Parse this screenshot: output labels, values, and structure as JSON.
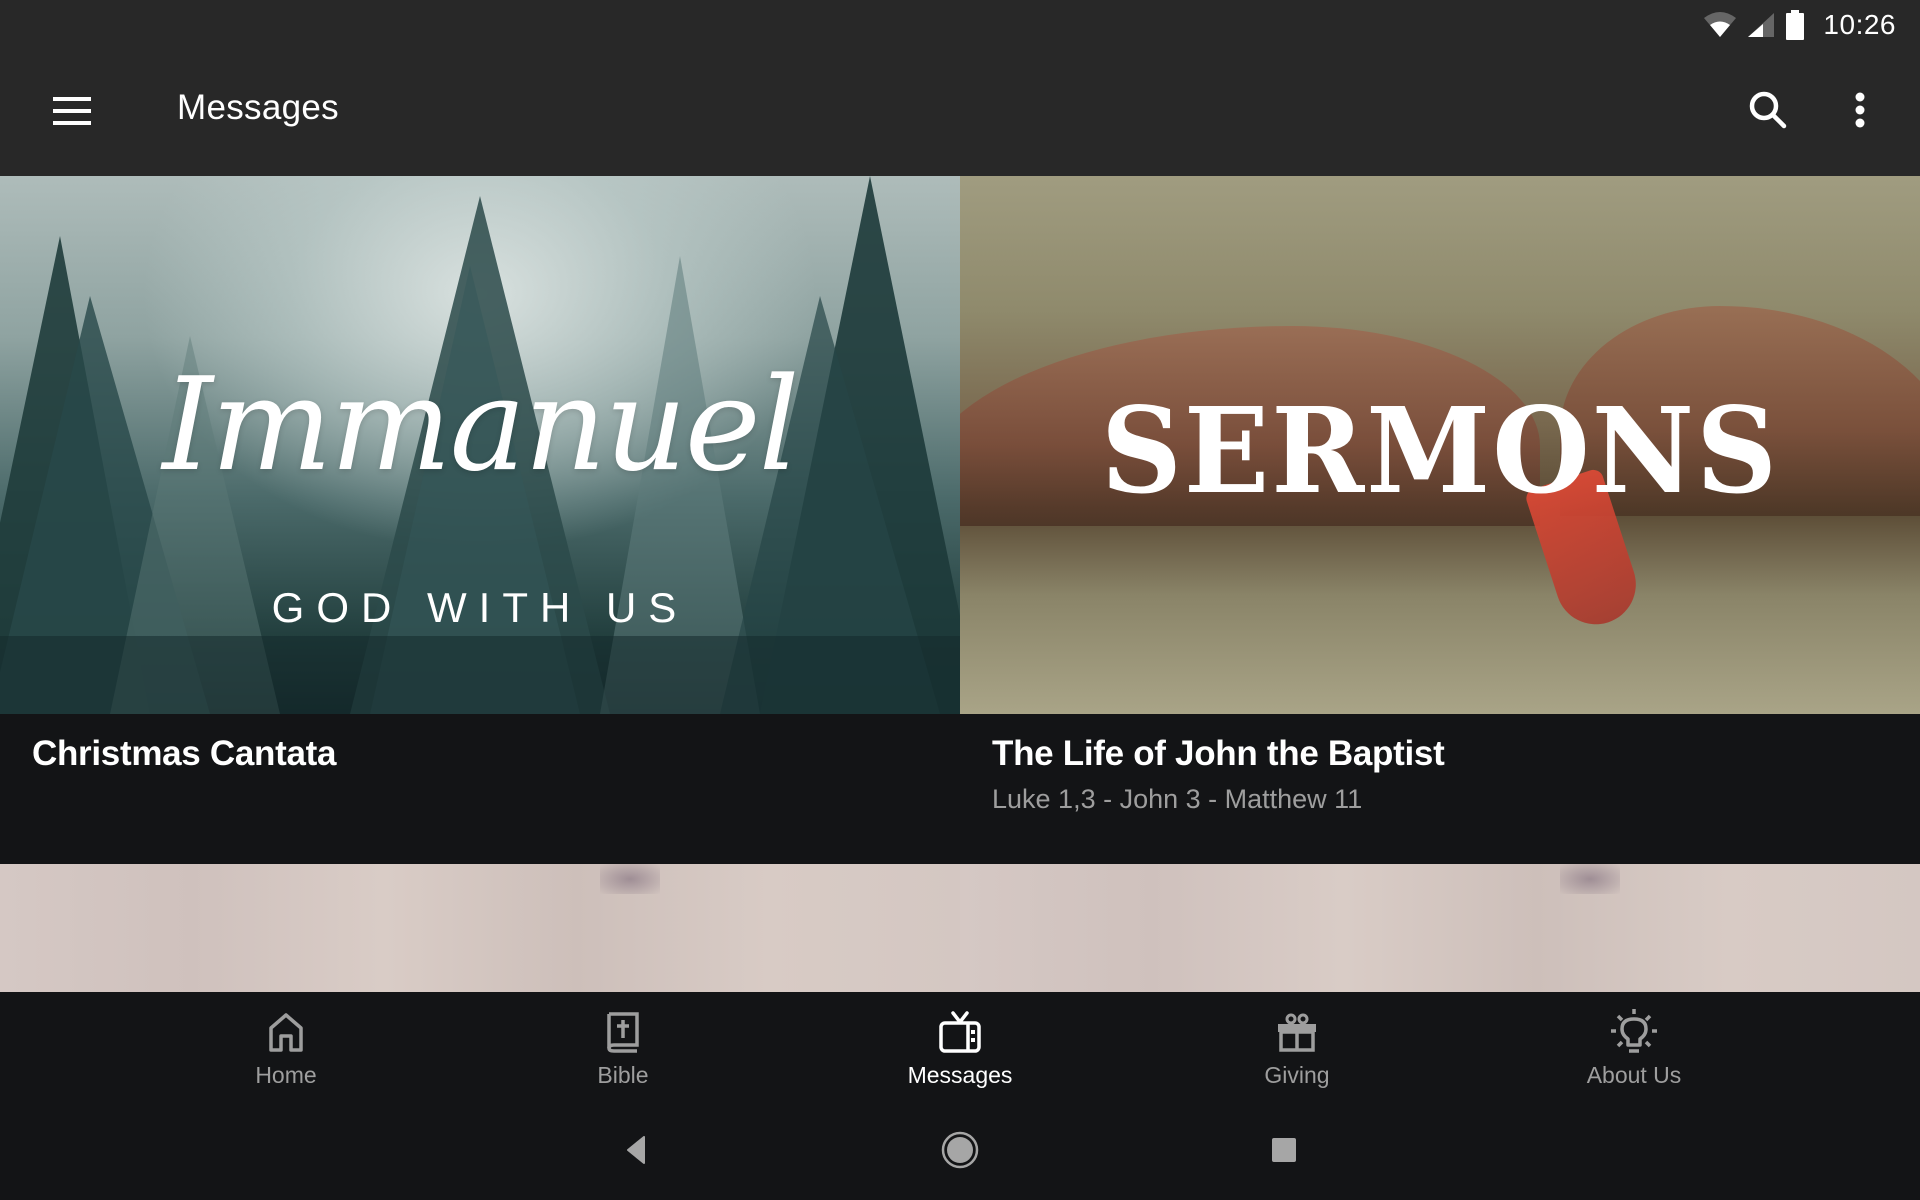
{
  "status_bar": {
    "time": "10:26",
    "icons": [
      "wifi-icon",
      "cell-signal-icon",
      "battery-icon"
    ]
  },
  "app_bar": {
    "title": "Messages",
    "menu_icon": "hamburger-menu-icon",
    "search_icon": "search-icon",
    "more_icon": "more-vert-icon"
  },
  "series": [
    {
      "title": "Christmas Cantata",
      "subtitle": "",
      "artwork": {
        "headline": "Immanuel",
        "tagline": "GOD WITH US"
      }
    },
    {
      "title": "The Life of John the Baptist",
      "subtitle": "Luke 1,3 - John 3 - Matthew 11",
      "artwork": {
        "headline": "SERMONS",
        "tagline": ""
      }
    }
  ],
  "bottom_nav": {
    "active": "Messages",
    "items": [
      {
        "label": "Home",
        "icon": "home-icon"
      },
      {
        "label": "Bible",
        "icon": "bible-icon"
      },
      {
        "label": "Messages",
        "icon": "tv-icon"
      },
      {
        "label": "Giving",
        "icon": "gift-icon"
      },
      {
        "label": "About Us",
        "icon": "lightbulb-icon"
      }
    ]
  },
  "system_nav": {
    "back": "back-icon",
    "home": "home-circle-icon",
    "recents": "recents-icon"
  },
  "colors": {
    "app_bar_bg": "#282828",
    "content_bg": "#131416",
    "active_nav": "#ffffff",
    "inactive_nav": "#9e9e9e",
    "subtitle": "#9e9e9e"
  }
}
